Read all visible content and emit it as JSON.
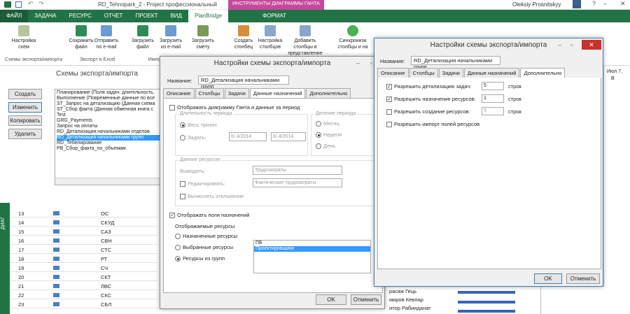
{
  "app": {
    "title": "RD_Tehnopark_2 - Project профессиональный",
    "context_tab": "ИНСТРУМЕНТЫ ДИАГРАММЫ ГАНТА",
    "user": "Oleksiy Prosnitskyy"
  },
  "ribbon_tabs": [
    "ФАЙЛ",
    "ЗАДАЧА",
    "РЕСУРС",
    "ОТЧЕТ",
    "ПРОЕКТ",
    "ВИД",
    "PlanBridge",
    "ФОРМАТ"
  ],
  "ribbon": {
    "buttons": [
      "Настройка схем",
      "Сохранить файл",
      "Отправить по e-mail",
      "Загрузить файл",
      "Загрузить из e-mail",
      "Загрузить смету",
      "Создать столбец",
      "Настройка столбцов",
      "Добавить столбцы в представление",
      "Синхронизи столбцы и на"
    ],
    "groups": [
      "Схемы экспорта/импорта",
      "Экспорт в Excel",
      "Импорт"
    ]
  },
  "schemes_panel": {
    "title": "Схемы экспорта/импорта",
    "buttons": [
      "Создать",
      "Изменить",
      "Копировать",
      "Удалить"
    ],
    "items": [
      "Планирование (Поля задач: длительность,",
      "Выполнение (Повременные данные по все",
      "ST_Запрос на детализацию (Данная схема",
      "ST_Сбор факта (Данная обменная книга с",
      "Test",
      "GRG_Payments",
      "Запрос на оплаты",
      "RD_Детализация начальниками отделов",
      "RD_Детализация начальниками групп",
      "RD_Тебелирование",
      "PB_Сбор_факта_по_объемам"
    ],
    "selected_index": 8
  },
  "grid": {
    "side_label": "ДИАГ",
    "rows": [
      {
        "num": "13",
        "name": "ОС"
      },
      {
        "num": "14",
        "name": "СКУД"
      },
      {
        "num": "15",
        "name": "САЗ"
      },
      {
        "num": "16",
        "name": "СВН"
      },
      {
        "num": "17",
        "name": "СТС"
      },
      {
        "num": "18",
        "name": "РТ"
      },
      {
        "num": "19",
        "name": "СЧ"
      },
      {
        "num": "20",
        "name": "СКТ"
      },
      {
        "num": "21",
        "name": "ЛВС"
      },
      {
        "num": "22",
        "name": "СКС"
      },
      {
        "num": "23",
        "name": "СБЛ"
      }
    ],
    "right_names": [
      "расюк Гець",
      "мирoв Кевлар",
      "итор Рабинданат"
    ],
    "date_header": "Июл 7,",
    "date_sub": "В"
  },
  "dialog1": {
    "title": "Настройки схемы экспорта/импорта",
    "name_label": "Название:",
    "name_value": "RD_Детализация начальниками групп",
    "tabs": [
      "Описание",
      "Столбцы",
      "Задачи",
      "Данные назначений",
      "Дополнительно"
    ],
    "active_tab": 3,
    "show_gantt": "Отображать диаграмму Ганта и данные за период",
    "period_group": "Длительность периода",
    "whole_project": "Весь проект",
    "set": "Задать:",
    "date_from": "5/ 4/2014",
    "date_to": "6/ 4/2014",
    "division_group": "Деление периода",
    "month": "Месяц",
    "week": "Неделя",
    "day": "День",
    "resources_group": "Данные ресурсов",
    "output": "Выводить:",
    "output_value": "Трудозатраты",
    "edit": "Редактировать:",
    "edit_value": "Фактические трудозатраты",
    "deviation": "Вычислять отклонение",
    "show_assign_fields": "Отображать поля назначений",
    "shown_resources": "Отображаемые ресурсы",
    "assigned": "Назначенные ресурсы",
    "selected": "Выбранные ресурсы",
    "from_group": "Ресурсы из групп",
    "list": [
      "ПБ",
      "Проектировщики"
    ],
    "ok": "OK",
    "cancel": "Отменить"
  },
  "dialog2": {
    "title": "Настройки схемы экспорта/импорта",
    "name_label": "Название:",
    "name_value": "RD_Детализация начальниками групп",
    "tabs": [
      "Описание",
      "Столбцы",
      "Задачи",
      "Данные назначений",
      "Дополнительно"
    ],
    "active_tab": 4,
    "opt1": "Разрешить детализацию задач:",
    "opt1_val": "5",
    "opt2": "Разрешить назначение ресурсов:",
    "opt2_val": "1",
    "opt3": "Разрешить создание ресурсов:",
    "opt3_val": "5",
    "rows_word": "строк",
    "opt4": "Разрешить импорт полей ресурсов",
    "ok": "OK",
    "cancel": "Отменить"
  },
  "colors": {
    "ribbon": "#217346",
    "selection": "#3399ff",
    "context_tab": "#c5489b"
  }
}
